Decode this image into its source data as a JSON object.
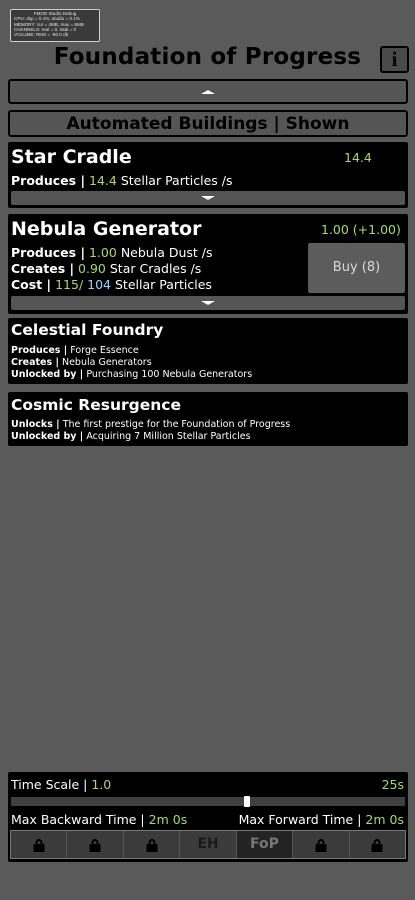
{
  "debug": {
    "title": "FMOD Studio Debug",
    "lines": [
      "CPU: dsp = 0.1%, studio = 0.1%",
      "MEMORY: cur = 4MB, max = 8MB",
      "CHANNELS: real = 0, total = 0",
      "VOLUME: RMS = -80.0 db"
    ]
  },
  "header": {
    "title": "Foundation of Progress",
    "info_label": "i"
  },
  "automated_toggle": {
    "label": "Automated Buildings | Shown"
  },
  "buildings": [
    {
      "name": "Star Cradle",
      "count": "14.4",
      "produces_label": "Produces |",
      "produces_value": "14.4",
      "produces_unit": "Stellar Particles /s"
    },
    {
      "name": "Nebula Generator",
      "count": "1.00 (+1.00)",
      "produces_label": "Produces |",
      "produces_value": "1.00",
      "produces_unit": "Nebula Dust /s",
      "creates_label": "Creates |",
      "creates_value": "0.90",
      "creates_unit": "Star Cradles /s",
      "cost_label": "Cost |",
      "cost_current": "115/",
      "cost_required": "104",
      "cost_unit": "Stellar Particles",
      "buy_label": "Buy (8)"
    }
  ],
  "locked": [
    {
      "name": "Celestial Foundry",
      "rows": [
        {
          "label": "Produces |",
          "value": "Forge Essence"
        },
        {
          "label": "Creates |",
          "value": "Nebula Generators"
        },
        {
          "label": "Unlocked by |",
          "value": "Purchasing 100 Nebula Generators"
        }
      ]
    },
    {
      "name": "Cosmic Resurgence",
      "rows": [
        {
          "label": "Unlocks |",
          "value": "The first prestige for the Foundation of Progress"
        },
        {
          "label": "Unlocked by |",
          "value": "Acquiring 7 Million Stellar Particles"
        }
      ]
    }
  ],
  "time": {
    "scale_label": "Time Scale |",
    "scale_value": "1.0",
    "stored": "25s",
    "slider_value": 0.6,
    "max_backward_label": "Max Backward Time |",
    "max_backward_value": "2m 0s",
    "max_forward_label": "Max Forward Time |",
    "max_forward_value": "2m 0s"
  },
  "tabs": [
    {
      "label": "",
      "icon": "lock-icon"
    },
    {
      "label": "",
      "icon": "lock-icon"
    },
    {
      "label": "",
      "icon": "lock-icon"
    },
    {
      "label": "EH"
    },
    {
      "label": "FoP",
      "active": true
    },
    {
      "label": "",
      "icon": "lock-icon"
    },
    {
      "label": "",
      "icon": "lock-icon"
    }
  ],
  "colors": {
    "green": "#a9d86e",
    "cyan": "#8fd9ff",
    "background": "#5a5a5a"
  }
}
